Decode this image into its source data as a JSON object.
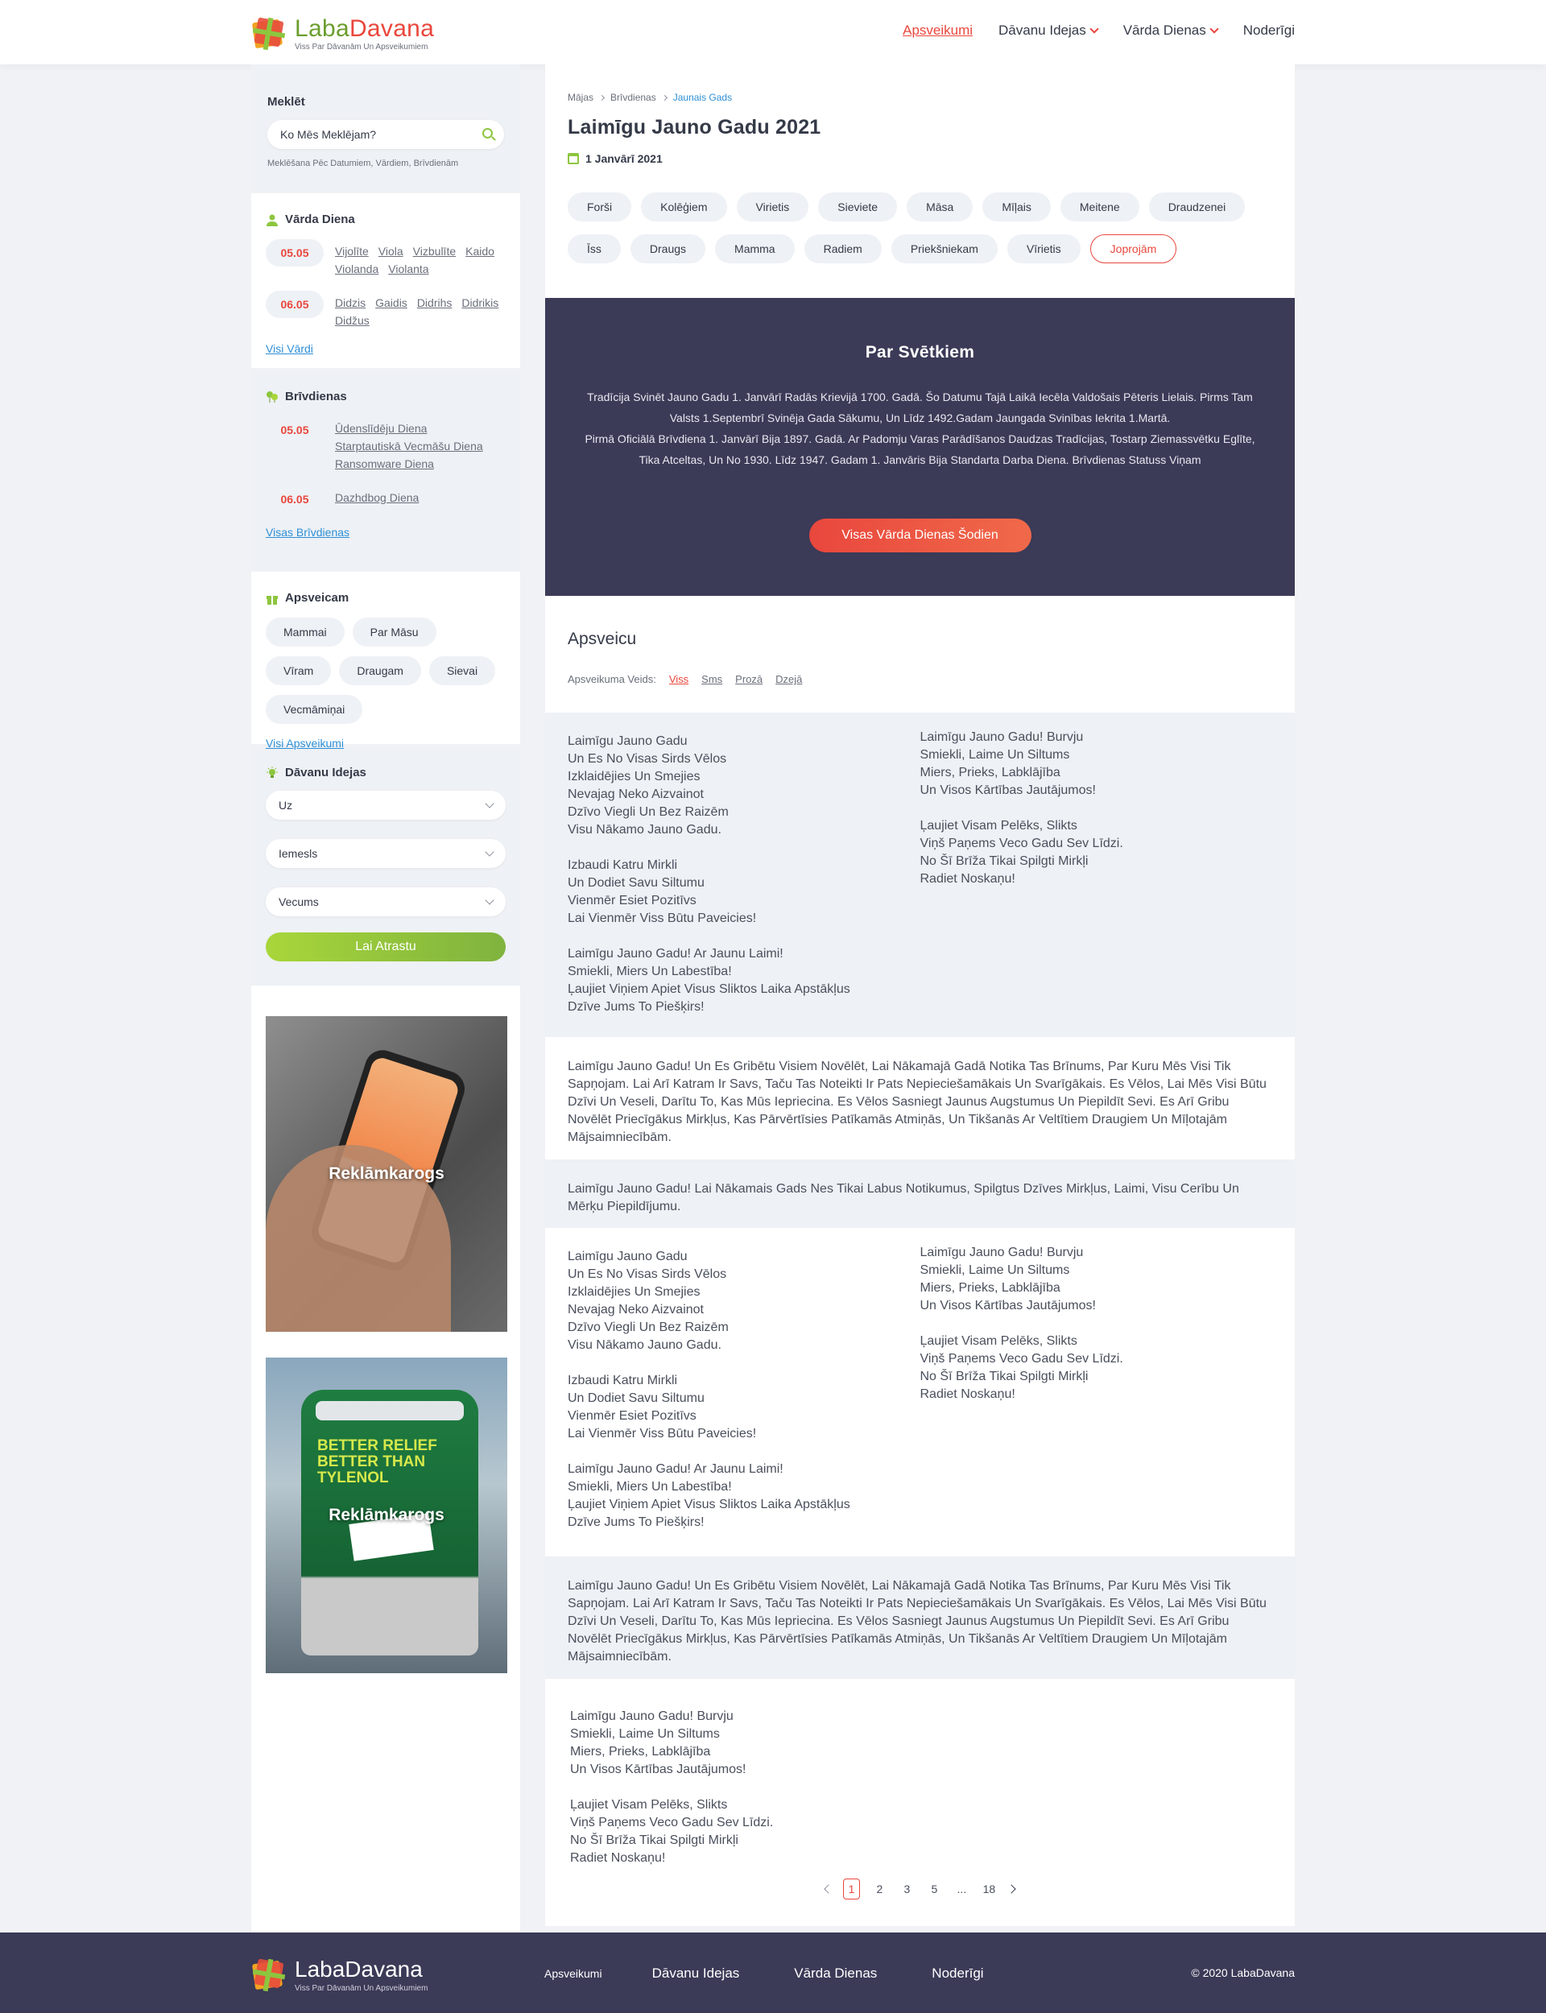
{
  "header": {
    "logo_part1": "Laba",
    "logo_part2": "Davana",
    "tagline": "Viss Par Dāvanām Un Apsveikumiem",
    "nav": [
      "Apsveikumi",
      "Dāvanu Idejas",
      "Vārda Dienas",
      "Noderīgi"
    ]
  },
  "sidebar": {
    "search_title": "Meklēt",
    "search_placeholder": "Ko Mēs Meklējam?",
    "search_hint": "Meklēšana Pēc Datumiem, Vārdiem, Brīvdienām",
    "name_days_title": "Vārda Diena",
    "name_days": [
      {
        "date": "05.05",
        "names": [
          "Vijolīte",
          "Viola",
          "Vizbulīte",
          "Kaido",
          "Violanda",
          "Violanta"
        ]
      },
      {
        "date": "06.05",
        "names": [
          "Didzis",
          "Gaidis",
          "Didrihs",
          "Didrikis",
          "Didžus"
        ]
      }
    ],
    "name_days_link": "Visi Vārdi",
    "holidays_title": "Brīvdienas",
    "holidays": [
      {
        "date": "05.05",
        "items": [
          "Ūdenslīdēju Diena",
          "Starptautiskā Vecmāšu Diena",
          "Ransomware Diena"
        ]
      },
      {
        "date": "06.05",
        "items": [
          "Dazhdbog Diena"
        ]
      }
    ],
    "holidays_link": "Visas Brīvdienas",
    "greet_title": "Apsveicam",
    "greet_tags": [
      "Mammai",
      "Par Māsu",
      "Vīram",
      "Draugam",
      "Sievai",
      "Vecmāmiņai"
    ],
    "greet_link": "Visi Apsveikumi",
    "gift_title": "Dāvanu Idejas",
    "gift_selects": [
      "Uz",
      "Iemesls",
      "Vecums"
    ],
    "gift_button": "Lai Atrastu",
    "ad_label_1": "Reklāmkarogs",
    "ad_label_2": "Reklāmkarogs",
    "ad2_text": "BETTER RELIEF\nBETTER THAN TYLENOL"
  },
  "main": {
    "breadcrumb": [
      "Mājas",
      "Brīvdienas",
      "Jaunais Gads"
    ],
    "title": "Laimīgu Jauno Gadu 2021",
    "date": "1 Janvārī 2021",
    "tags": [
      "Forši",
      "Kolēģiem",
      "Virietis",
      "Sieviete",
      "Māsa",
      "Mīļais",
      "Meitene",
      "Draudzenei",
      "Īss",
      "Draugs",
      "Mamma",
      "Radiem",
      "Priekšniekam",
      "Vīrietis"
    ],
    "tags_more": "Joprojām",
    "about_title": "Par Svētkiem",
    "about_text_1": "Tradīcija Svinēt Jauno Gadu 1. Janvārī Radās Krievijā 1700. Gadā. Šo Datumu Tajā Laikā Iecēla Valdošais Pēteris Lielais. Pirms Tam Valsts 1.Septembrī Svinēja Gada Sākumu, Un Līdz 1492.Gadam Jaungada Svinības Iekrita 1.Martā.",
    "about_text_2": "Pirmā Oficiālā Brīvdiena 1. Janvārī Bija 1897. Gadā. Ar Padomju Varas Parādīšanos Daudzas Tradīcijas, Tostarp Ziemassvētku Eglīte, Tika Atceltas, Un No 1930. Līdz 1947. Gadam 1. Janvāris Bija Standarta Darba Diena. Brīvdienas Statuss Viņam",
    "about_button": "Visas Vārda Dienas Šodien",
    "greetings_title": "Apsveicu",
    "greet_type_label": "Apsveikuma Veids:",
    "greet_types": [
      "Viss",
      "Sms",
      "Prozā",
      "Dzejā"
    ],
    "poem_long": "Laimīgu Jauno Gadu\nUn Es No Visas Sirds Vēlos\nIzklaidējies Un Smejies\nNevajag Neko Aizvainot\nDzīvo Viegli Un Bez Raizēm\nVisu Nākamo Jauno Gadu.\n\nIzbaudi Katru Mirkli\nUn Dodiet Savu Siltumu\nVienmēr Esiet Pozitīvs\nLai Vienmēr Viss Būtu Paveicies!\n\nLaimīgu Jauno Gadu! Ar Jaunu Laimi!\nSmiekli, Miers Un Labestība!\nĻaujiet Viņiem Apiet Visus Sliktos Laika Apstākļus\nDzīve Jums To Piešķirs!",
    "poem_short": "Laimīgu Jauno Gadu! Burvju\nSmiekli, Laime Un Siltums\nMiers, Prieks, Labklājība\nUn Visos Kārtības Jautājumos!\n\nĻaujiet Visam Pelēks, Slikts\nViņš Paņems Veco Gadu Sev Līdzi.\nNo Šī Brīža Tikai Spilgti Mirkļi\nRadiet Noskaņu!",
    "prose_long": "Laimīgu Jauno Gadu! Un Es Gribētu Visiem Novēlēt, Lai Nākamajā Gadā Notika Tas Brīnums, Par Kuru Mēs Visi Tik Sapņojam. Lai Arī Katram Ir Savs, Taču Tas Noteikti Ir Pats Nepieciešamākais Un Svarīgākais. Es Vēlos, Lai Mēs Visi Būtu Dzīvi Un Veseli, Darītu To, Kas Mūs Iepriecina. Es Vēlos Sasniegt Jaunus Augstumus Un Piepildīt Sevi. Es Arī Gribu Novēlēt Priecīgākus Mirkļus, Kas Pārvērtīsies Patīkamās Atmiņās, Un Tikšanās Ar Veltītiem Draugiem Un Mīļotajām Mājsaimniecībām.",
    "prose_short": "Laimīgu Jauno Gadu! Lai Nākamais Gads Nes Tikai Labus Notikumus, Spilgtus Dzīves Mirkļus, Laimi, Visu Cerību Un Mērķu Piepildījumu.",
    "pager": [
      "1",
      "2",
      "3",
      "5",
      "...",
      "18"
    ]
  },
  "footer": {
    "logo": "LabaDavana",
    "tagline": "Viss Par Dāvanām Un Apsveikumiem",
    "nav": [
      "Apsveikumi",
      "Dāvanu Idejas",
      "Vārda Dienas",
      "Noderīgi"
    ],
    "copyright": "© 2020 LabaDavana"
  },
  "colors": {
    "accent_red": "#e9473d",
    "accent_green": "#8dc63f",
    "dark_panel": "#3b3a57",
    "link_blue": "#2d8fd6"
  }
}
